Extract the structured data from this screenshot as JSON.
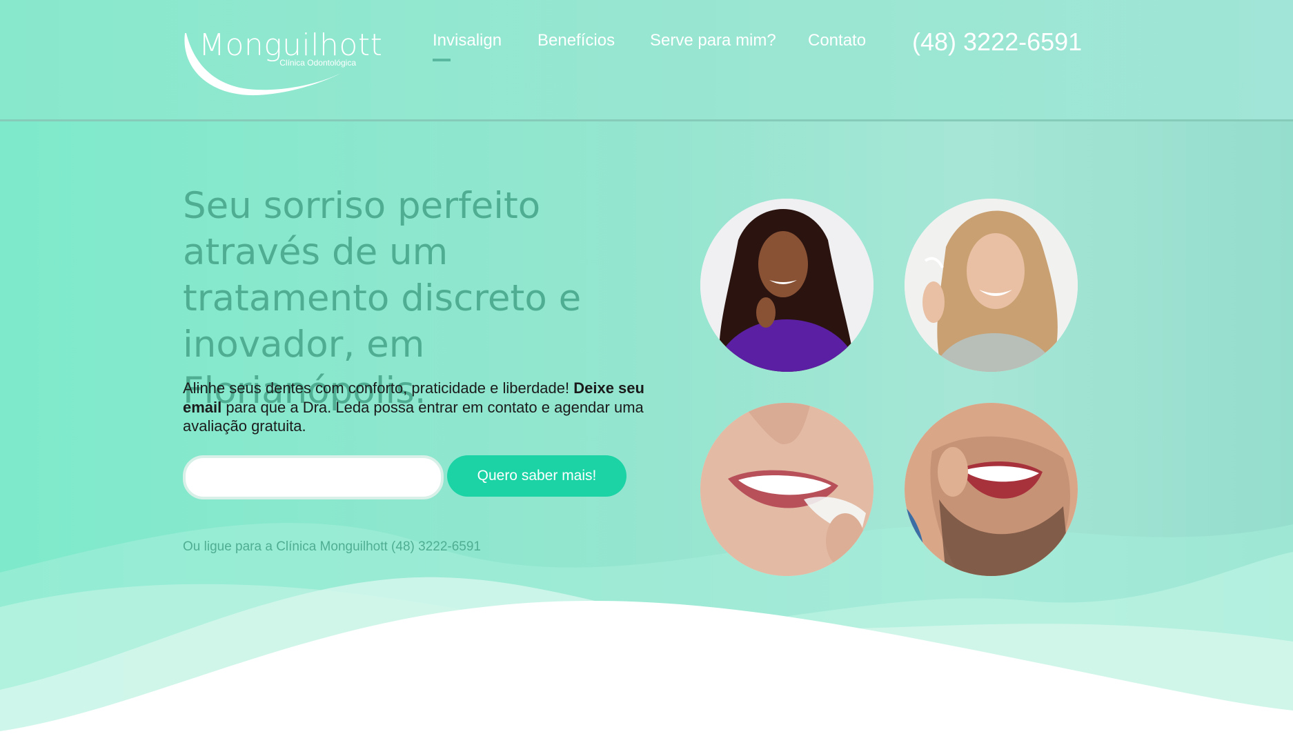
{
  "brand": {
    "name": "Monguilhott",
    "subtitle": "Clínica Odontológica"
  },
  "nav": {
    "items": [
      {
        "label": "Invisalign",
        "active": true
      },
      {
        "label": "Benefícios",
        "active": false
      },
      {
        "label": "Serve para mim?",
        "active": false
      },
      {
        "label": "Contato",
        "active": false
      }
    ],
    "phone": "(48) 3222-6591"
  },
  "hero": {
    "title": "Seu sorriso perfeito através de um tratamento discreto e inovador, em Florianópolis.",
    "desc_part1": "Alinhe seus dentes com conforto, praticidade e liberdade! ",
    "desc_bold": "Deixe seu email",
    "desc_part2": " para que a Dra. Leda possa entrar em contato e agendar uma avaliação gratuita.",
    "email": {
      "value": "",
      "placeholder": ""
    },
    "cta_label": "Quero saber mais!",
    "call_text": "Ou ligue para a Clínica Monguilhott (48) 3222-6591"
  },
  "photos": [
    {
      "name": "woman-curly-hair-aligner"
    },
    {
      "name": "woman-blonde-aligner"
    },
    {
      "name": "smile-closeup-aligner"
    },
    {
      "name": "man-beard-inserting-aligner"
    }
  ],
  "colors": {
    "accent": "#1cd3a6",
    "heading": "#4fae92",
    "background": "#8ee7cd",
    "nav_active_underline": "#59b89f"
  }
}
